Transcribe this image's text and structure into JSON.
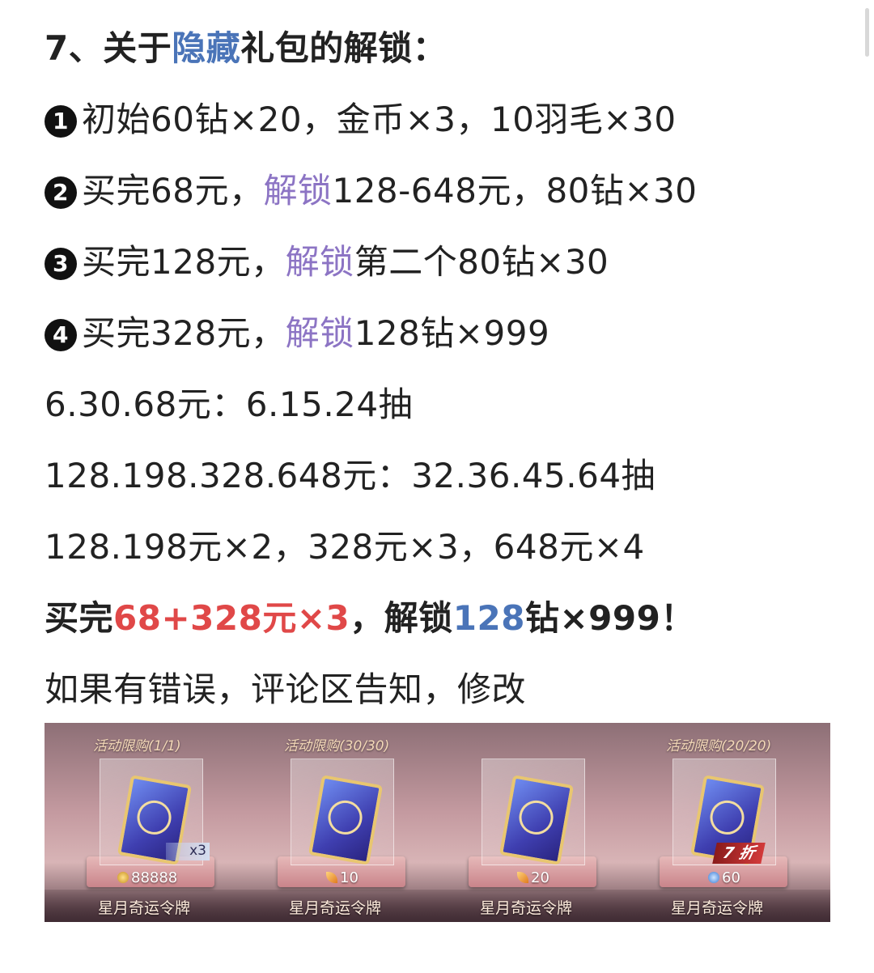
{
  "heading": {
    "prefix": "7、关于",
    "highlight": "隐藏",
    "suffix": "礼包的解锁：",
    "highlight_color": "#4a74b8"
  },
  "items": [
    {
      "bullet": "1",
      "parts": [
        {
          "text": "初始60钻×20，金币×3，10羽毛×30",
          "style": "plain"
        }
      ]
    },
    {
      "bullet": "2",
      "parts": [
        {
          "text": "买完68元，",
          "style": "plain"
        },
        {
          "text": "解锁",
          "style": "purple"
        },
        {
          "text": "128-648元，80钻×30",
          "style": "plain"
        }
      ]
    },
    {
      "bullet": "3",
      "parts": [
        {
          "text": "买完128元，",
          "style": "plain"
        },
        {
          "text": "解锁",
          "style": "purple"
        },
        {
          "text": "第二个80钻×30",
          "style": "plain"
        }
      ]
    },
    {
      "bullet": "4",
      "parts": [
        {
          "text": "买完328元，",
          "style": "plain"
        },
        {
          "text": "解锁",
          "style": "purple"
        },
        {
          "text": "128钻×999",
          "style": "plain"
        }
      ]
    }
  ],
  "lines": {
    "l1": "6.30.68元：6.15.24抽",
    "l2": "128.198.328.648元：32.36.45.64抽",
    "l3": "128.198元×2，328元×3，648元×4"
  },
  "summary": {
    "a": "买完",
    "b": "68+328元×3",
    "c": "，解锁",
    "d": "128",
    "e": "钻×999！",
    "red_color": "#e04848",
    "blue_color": "#4a74b8"
  },
  "footer": "如果有错误，评论区告知，修改",
  "shop_cards": [
    {
      "title": "活动限购(1/1)",
      "price": "88888",
      "currency_icon": "coin-icon",
      "badge": "x3",
      "name": "星月奇运令牌"
    },
    {
      "title": "活动限购(30/30)",
      "price": "10",
      "currency_icon": "feather-icon",
      "badge": "",
      "name": "星月奇运令牌"
    },
    {
      "title": "",
      "price": "20",
      "currency_icon": "feather-icon",
      "badge": "",
      "name": "星月奇运令牌"
    },
    {
      "title": "活动限购(20/20)",
      "price": "60",
      "currency_icon": "diamond-icon",
      "badge": "7 折",
      "name": "星月奇运令牌"
    }
  ]
}
